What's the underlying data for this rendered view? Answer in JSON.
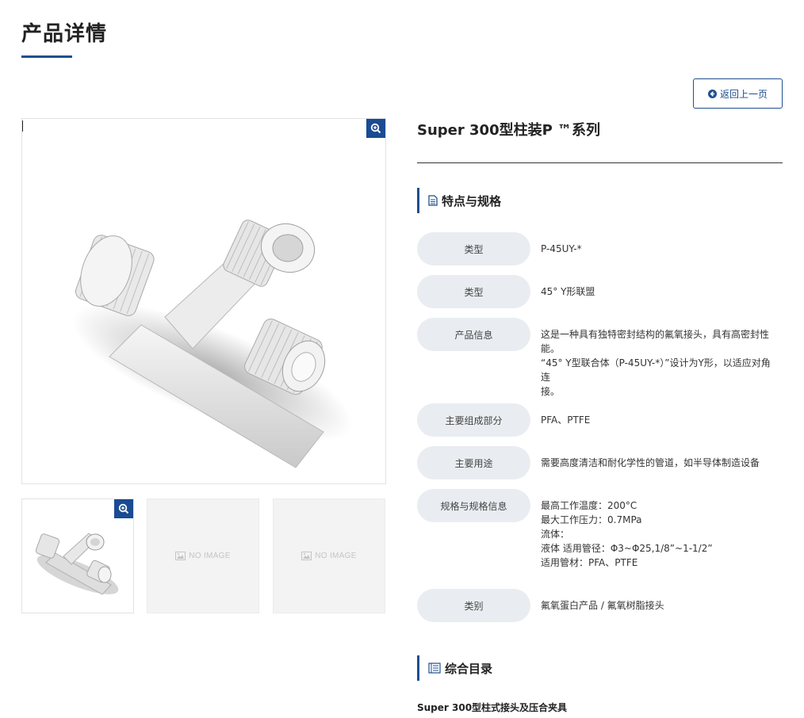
{
  "page": {
    "title": "产品详情"
  },
  "back_button": {
    "label": "返回上一页"
  },
  "product": {
    "name": "Super 300型柱装P ™系列",
    "thumbnails": [
      {
        "type": "image"
      },
      {
        "type": "placeholder",
        "label": "NO IMAGE"
      },
      {
        "type": "placeholder",
        "label": "NO IMAGE"
      }
    ]
  },
  "specs_section": {
    "title": "特点与规格",
    "rows": [
      {
        "label": "类型",
        "value": [
          "P-45UY-*"
        ]
      },
      {
        "label": "类型",
        "value": [
          "45° Y形联盟"
        ]
      },
      {
        "label": "产品信息",
        "value": [
          "这是一种具有独特密封结构的氟氧接头，具有高密封性",
          "能。",
          "“45° Y型联合体（P-45UY-*）”设计为Y形，以适应对角连",
          "接。"
        ]
      },
      {
        "label": "主要组成部分",
        "value": [
          "PFA、PTFE"
        ]
      },
      {
        "label": "主要用途",
        "value": [
          "需要高度清洁和耐化学性的管道，如半导体制造设备"
        ]
      },
      {
        "label": "规格与规格信息",
        "value": [
          "最高工作温度：200°C",
          "最大工作压力：0.7MPa",
          "流体：",
          "液体 适用管径：Φ3~Φ25,1/8”~1-1/2”",
          "适用管材：PFA、PTFE"
        ]
      },
      {
        "label": "类别",
        "value": [
          "氟氧蛋白产品 / 氟氧树脂接头"
        ]
      }
    ]
  },
  "catalog_section": {
    "title": "综合目录",
    "items": [
      "Super 300型柱式接头及压合夹具"
    ]
  },
  "colors": {
    "accent": "#1e4f8f",
    "label_bg": "#e9edf1",
    "placeholder_bg": "#f3f3f3"
  },
  "icons": [
    "magnify-plus-icon",
    "arrow-left-circle-icon",
    "document-icon",
    "book-icon",
    "image-icon"
  ]
}
